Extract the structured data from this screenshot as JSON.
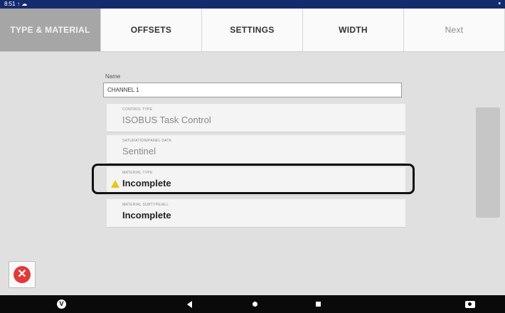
{
  "status_bar": {
    "time": "8:51",
    "signal": "↑ ☁",
    "battery": "▾"
  },
  "tabs": [
    {
      "label": "TYPE & MATERIAL",
      "active": true
    },
    {
      "label": "OFFSETS",
      "active": false
    },
    {
      "label": "SETTINGS",
      "active": false
    },
    {
      "label": "WIDTH",
      "active": false
    },
    {
      "label": "Next",
      "active": false
    }
  ],
  "form": {
    "name_label": "Name",
    "name_value": "CHANNEL 1",
    "fields": [
      {
        "label": "CONTROL TYPE",
        "value": "ISOBUS Task Control",
        "state": "disabled"
      },
      {
        "label": "SATURATION/PANEL DATA",
        "value": "Sentinel",
        "state": "disabled"
      },
      {
        "label": "MATERIAL TYPE",
        "value": "Incomplete",
        "state": "warning"
      },
      {
        "label": "MATERIAL SUBTYPE/ALL",
        "value": "Incomplete",
        "state": "normal"
      }
    ]
  },
  "colors": {
    "accent_dark": "#142c6e",
    "active_tab": "#a6a6a6",
    "warning": "#e8c419",
    "close_red": "#e03a3a"
  },
  "icons": {
    "close": "close-icon",
    "warning": "warning-icon",
    "back": "back-icon",
    "home": "home-icon",
    "recents": "recents-icon",
    "camera": "camera-icon",
    "app_logo": "v-logo-icon"
  }
}
